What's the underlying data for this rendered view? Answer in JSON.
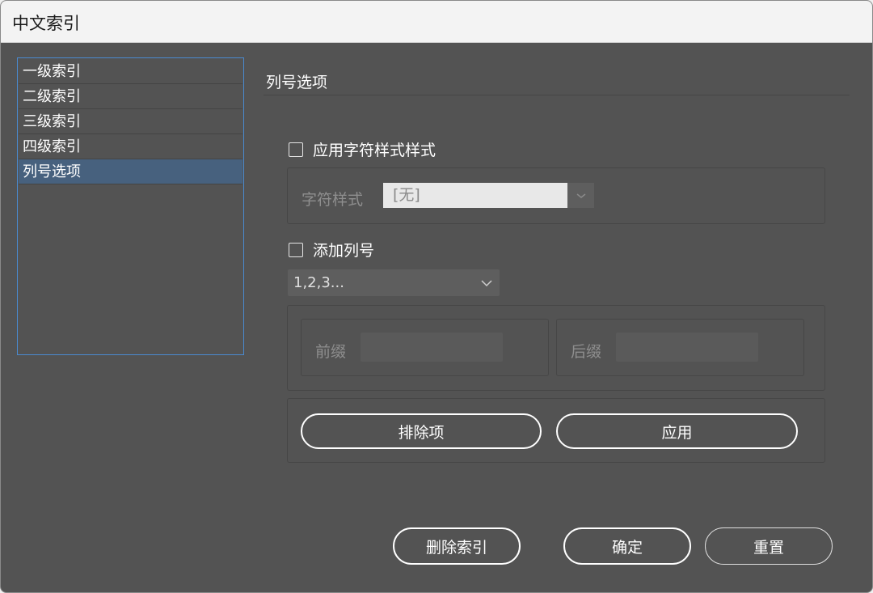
{
  "window": {
    "title": "中文索引"
  },
  "sidebar": {
    "items": [
      {
        "label": "一级索引",
        "selected": false
      },
      {
        "label": "二级索引",
        "selected": false
      },
      {
        "label": "三级索引",
        "selected": false
      },
      {
        "label": "四级索引",
        "selected": false
      },
      {
        "label": "列号选项",
        "selected": true
      }
    ]
  },
  "panel": {
    "section_title": "列号选项",
    "apply_char_style": {
      "label": "应用字符样式样式",
      "checked": false
    },
    "char_style": {
      "label": "字符样式",
      "value": "[无]"
    },
    "add_number": {
      "label": "添加列号",
      "checked": false
    },
    "number_format": {
      "value": "1,2,3..."
    },
    "prefix": {
      "label": "前缀",
      "value": ""
    },
    "suffix": {
      "label": "后缀",
      "value": ""
    },
    "exclude_button": "排除项",
    "apply_button": "应用"
  },
  "footer": {
    "delete_button": "删除索引",
    "ok_button": "确定",
    "reset_button": "重置"
  },
  "colors": {
    "dialog_bg": "#535353",
    "selection": "#47617e",
    "focus_border": "#4a8ad0"
  }
}
